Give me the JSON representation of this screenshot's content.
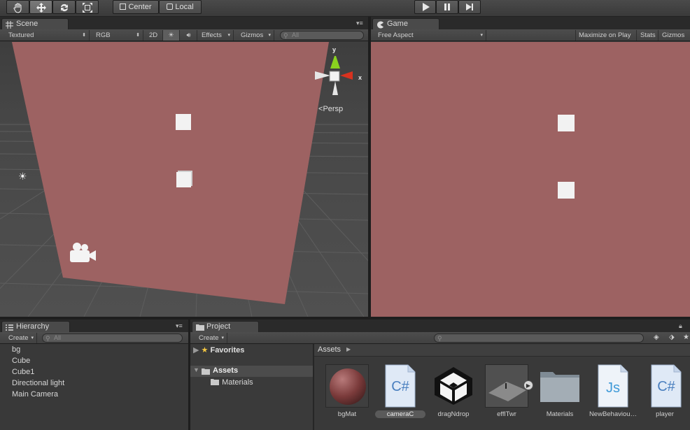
{
  "toolbar": {
    "tools": [
      "hand-tool",
      "move-tool",
      "rotate-tool",
      "scale-tool"
    ],
    "pivot": "Center",
    "space": "Local",
    "play": "play",
    "pause": "pause",
    "step": "step"
  },
  "scene": {
    "tab": "Scene",
    "shading": "Textured",
    "render_mode": "RGB",
    "mode_2d": "2D",
    "effects": "Effects",
    "gizmos": "Gizmos",
    "search_placeholder": "All",
    "gizmo_y": "y",
    "gizmo_x": "x",
    "persp": "Persp"
  },
  "game": {
    "tab": "Game",
    "aspect": "Free Aspect",
    "maximize": "Maximize on Play",
    "stats": "Stats",
    "gizmos": "Gizmos"
  },
  "hierarchy": {
    "tab": "Hierarchy",
    "create": "Create",
    "search_placeholder": "All",
    "items": [
      "bg",
      "Cube",
      "Cube1",
      "Directional light",
      "Main Camera"
    ]
  },
  "project": {
    "tab": "Project",
    "create": "Create",
    "favorites": "Favorites",
    "assets": "Assets",
    "materials": "Materials",
    "breadcrumb": "Assets",
    "files": [
      {
        "name": "bgMat",
        "icon": "material-sphere-icon"
      },
      {
        "name": "cameraC",
        "icon": "csharp-script-icon"
      },
      {
        "name": "dragNdrop",
        "icon": "unity-logo-icon"
      },
      {
        "name": "efflTwr",
        "icon": "prefab-model-icon"
      },
      {
        "name": "Materials",
        "icon": "folder-icon"
      },
      {
        "name": "NewBehaviou…",
        "icon": "js-script-icon"
      },
      {
        "name": "player",
        "icon": "csharp-script-icon"
      }
    ]
  },
  "colors": {
    "background_plane": "#9d6262",
    "accent": "#5a7fbf"
  }
}
